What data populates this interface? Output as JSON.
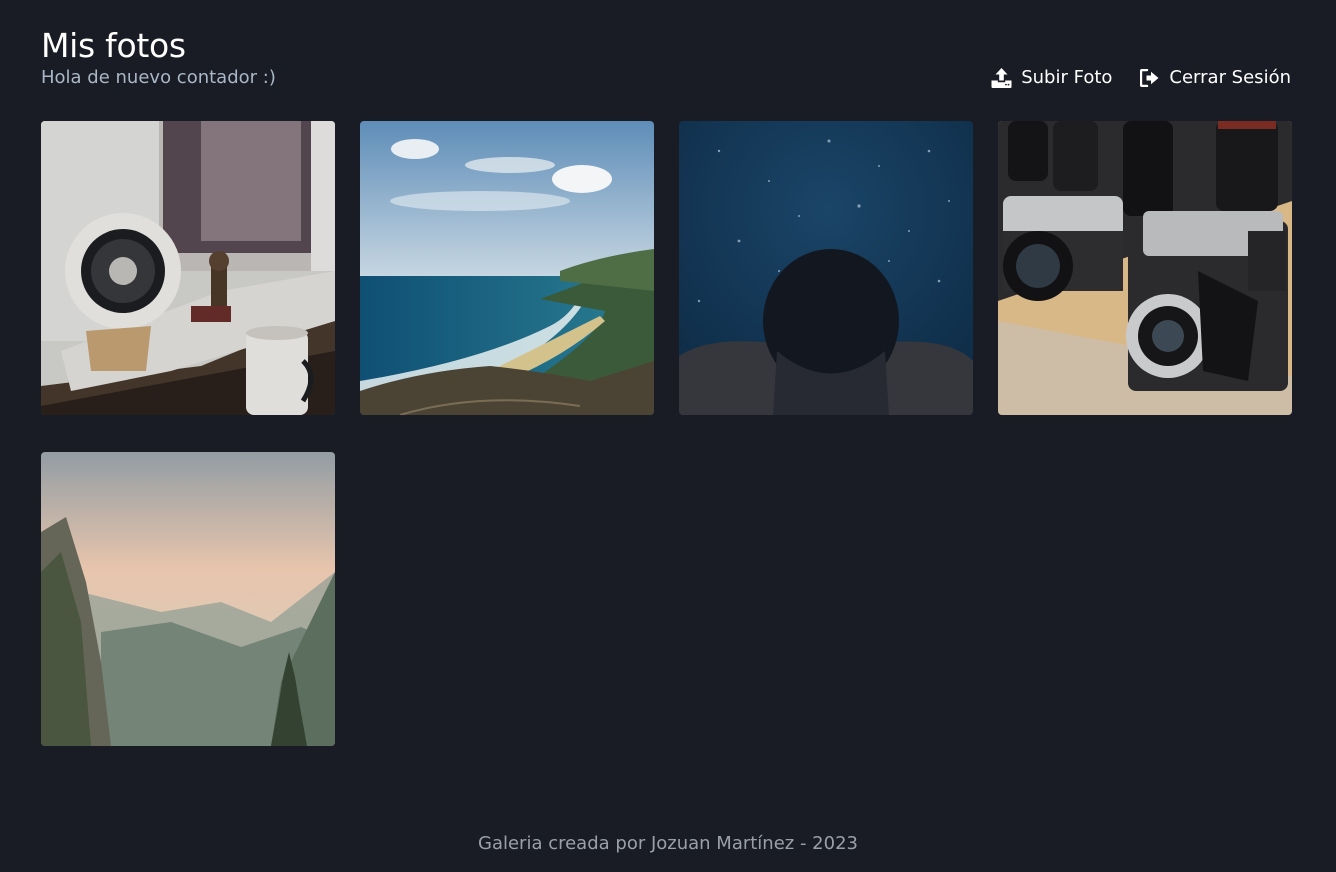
{
  "header": {
    "title": "Mis fotos",
    "subtitle": "Hola de nuevo contador :)"
  },
  "actions": {
    "upload": {
      "label": "Subir Foto",
      "icon": "upload-icon"
    },
    "logout": {
      "label": "Cerrar Sesión",
      "icon": "sign-out-icon"
    }
  },
  "gallery": {
    "photos": [
      {
        "subject": "desk-speaker",
        "icon": "photo-desk-speaker"
      },
      {
        "subject": "coastline",
        "icon": "photo-coastline"
      },
      {
        "subject": "underwater-swimmer",
        "icon": "photo-underwater"
      },
      {
        "subject": "vintage-cameras",
        "icon": "photo-cameras"
      },
      {
        "subject": "mountain-valley",
        "icon": "photo-valley"
      }
    ]
  },
  "footer": {
    "text": "Galeria creada por Jozuan Martínez - 2023"
  },
  "colors": {
    "background": "#1a1c25",
    "title": "#ffffff",
    "subtitle": "#a9b7c6",
    "footer": "#9aa0a9"
  }
}
